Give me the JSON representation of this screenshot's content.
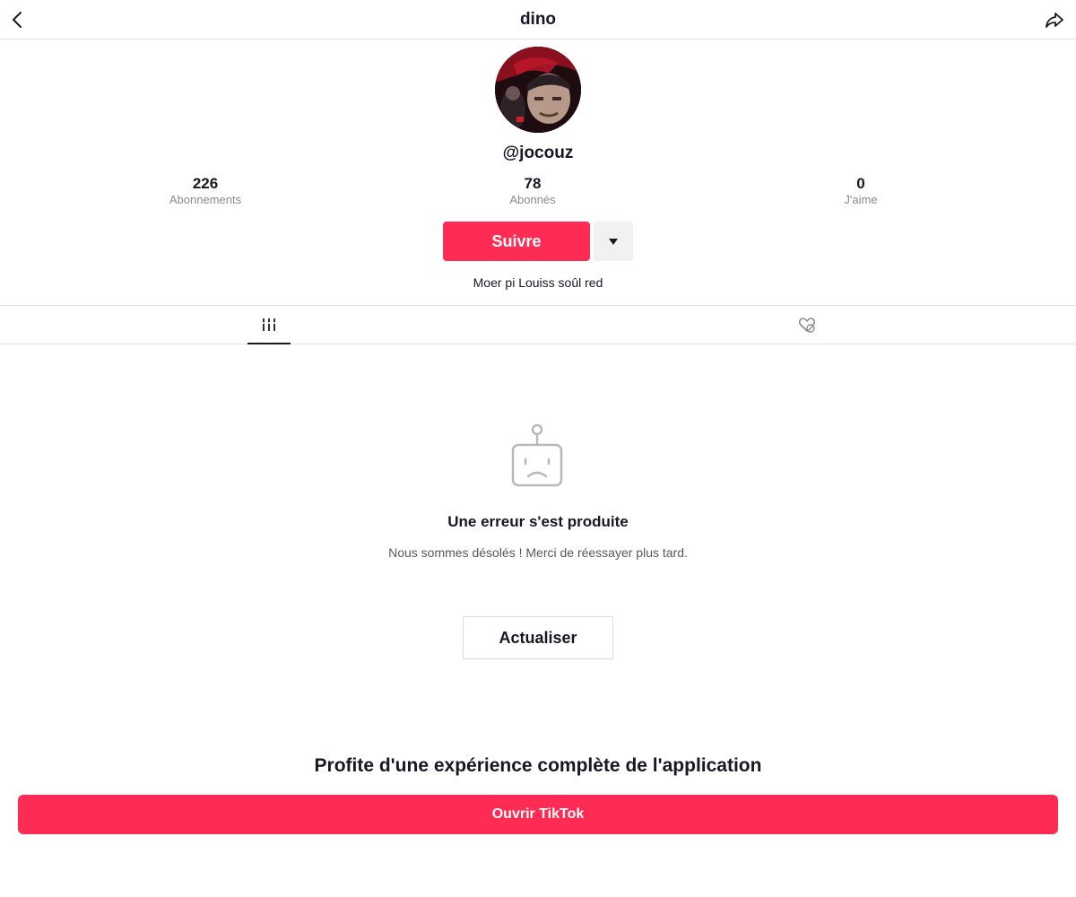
{
  "header": {
    "title": "dino",
    "back_icon": "chevron-left-icon",
    "share_icon": "share-arrow-icon"
  },
  "profile": {
    "username": "@jocouz",
    "bio": "Moer pi Louiss soûl red",
    "stats": [
      {
        "value": "226",
        "label": "Abonnements"
      },
      {
        "value": "78",
        "label": "Abonnés"
      },
      {
        "value": "0",
        "label": "J'aime"
      }
    ],
    "follow_label": "Suivre",
    "more_icon": "caret-down-icon"
  },
  "tabs": {
    "videos_icon": "video-grid-icon",
    "liked_icon": "liked-heart-icon"
  },
  "error": {
    "icon": "sad-robot-icon",
    "title": "Une erreur s'est produite",
    "message": "Nous sommes désolés ! Merci de réessayer plus tard.",
    "refresh_label": "Actualiser"
  },
  "promo": {
    "text": "Profite d'une expérience complète de l'application",
    "open_label": "Ouvrir TikTok"
  },
  "colors": {
    "accent": "#fe2c55",
    "text": "#161823",
    "muted": "#8a8b91",
    "border": "#e3e3e4"
  }
}
